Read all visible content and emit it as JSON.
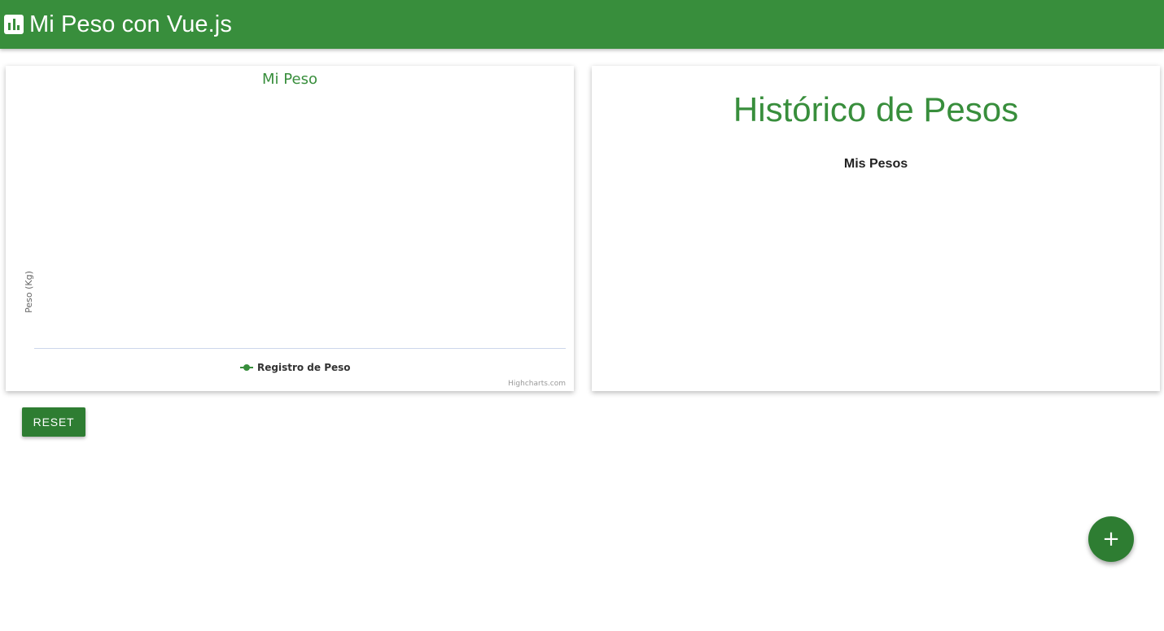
{
  "app_bar": {
    "title": "Mi Peso con Vue.js",
    "icon": "bar-chart-icon",
    "color": "#388e3c"
  },
  "chart_data": {
    "type": "line",
    "title": "Mi Peso",
    "xlabel": "",
    "ylabel": "Peso (Kg)",
    "series": [
      {
        "name": "Registro de Peso",
        "values": []
      }
    ],
    "grid": true,
    "legend": "bottom-center",
    "color": "#388e3c"
  },
  "chart_card": {
    "credits": "Highcharts.com"
  },
  "history_card": {
    "title": "Histórico de Pesos",
    "subtitle": "Mis Pesos",
    "items": []
  },
  "actions": {
    "reset_label": "RESET",
    "fab_label": "+",
    "fab_icon": "plus-icon"
  }
}
